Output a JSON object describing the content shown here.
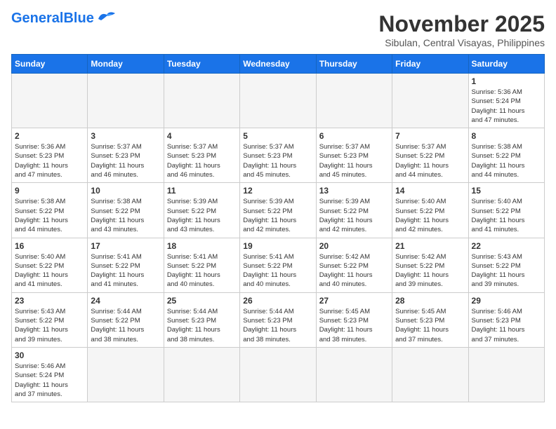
{
  "header": {
    "logo_general": "General",
    "logo_blue": "Blue",
    "month_title": "November 2025",
    "location": "Sibulan, Central Visayas, Philippines"
  },
  "days_of_week": [
    "Sunday",
    "Monday",
    "Tuesday",
    "Wednesday",
    "Thursday",
    "Friday",
    "Saturday"
  ],
  "weeks": [
    [
      {
        "day": "",
        "info": ""
      },
      {
        "day": "",
        "info": ""
      },
      {
        "day": "",
        "info": ""
      },
      {
        "day": "",
        "info": ""
      },
      {
        "day": "",
        "info": ""
      },
      {
        "day": "",
        "info": ""
      },
      {
        "day": "1",
        "info": "Sunrise: 5:36 AM\nSunset: 5:24 PM\nDaylight: 11 hours\nand 47 minutes."
      }
    ],
    [
      {
        "day": "2",
        "info": "Sunrise: 5:36 AM\nSunset: 5:23 PM\nDaylight: 11 hours\nand 47 minutes."
      },
      {
        "day": "3",
        "info": "Sunrise: 5:37 AM\nSunset: 5:23 PM\nDaylight: 11 hours\nand 46 minutes."
      },
      {
        "day": "4",
        "info": "Sunrise: 5:37 AM\nSunset: 5:23 PM\nDaylight: 11 hours\nand 46 minutes."
      },
      {
        "day": "5",
        "info": "Sunrise: 5:37 AM\nSunset: 5:23 PM\nDaylight: 11 hours\nand 45 minutes."
      },
      {
        "day": "6",
        "info": "Sunrise: 5:37 AM\nSunset: 5:23 PM\nDaylight: 11 hours\nand 45 minutes."
      },
      {
        "day": "7",
        "info": "Sunrise: 5:37 AM\nSunset: 5:22 PM\nDaylight: 11 hours\nand 44 minutes."
      },
      {
        "day": "8",
        "info": "Sunrise: 5:38 AM\nSunset: 5:22 PM\nDaylight: 11 hours\nand 44 minutes."
      }
    ],
    [
      {
        "day": "9",
        "info": "Sunrise: 5:38 AM\nSunset: 5:22 PM\nDaylight: 11 hours\nand 44 minutes."
      },
      {
        "day": "10",
        "info": "Sunrise: 5:38 AM\nSunset: 5:22 PM\nDaylight: 11 hours\nand 43 minutes."
      },
      {
        "day": "11",
        "info": "Sunrise: 5:39 AM\nSunset: 5:22 PM\nDaylight: 11 hours\nand 43 minutes."
      },
      {
        "day": "12",
        "info": "Sunrise: 5:39 AM\nSunset: 5:22 PM\nDaylight: 11 hours\nand 42 minutes."
      },
      {
        "day": "13",
        "info": "Sunrise: 5:39 AM\nSunset: 5:22 PM\nDaylight: 11 hours\nand 42 minutes."
      },
      {
        "day": "14",
        "info": "Sunrise: 5:40 AM\nSunset: 5:22 PM\nDaylight: 11 hours\nand 42 minutes."
      },
      {
        "day": "15",
        "info": "Sunrise: 5:40 AM\nSunset: 5:22 PM\nDaylight: 11 hours\nand 41 minutes."
      }
    ],
    [
      {
        "day": "16",
        "info": "Sunrise: 5:40 AM\nSunset: 5:22 PM\nDaylight: 11 hours\nand 41 minutes."
      },
      {
        "day": "17",
        "info": "Sunrise: 5:41 AM\nSunset: 5:22 PM\nDaylight: 11 hours\nand 41 minutes."
      },
      {
        "day": "18",
        "info": "Sunrise: 5:41 AM\nSunset: 5:22 PM\nDaylight: 11 hours\nand 40 minutes."
      },
      {
        "day": "19",
        "info": "Sunrise: 5:41 AM\nSunset: 5:22 PM\nDaylight: 11 hours\nand 40 minutes."
      },
      {
        "day": "20",
        "info": "Sunrise: 5:42 AM\nSunset: 5:22 PM\nDaylight: 11 hours\nand 40 minutes."
      },
      {
        "day": "21",
        "info": "Sunrise: 5:42 AM\nSunset: 5:22 PM\nDaylight: 11 hours\nand 39 minutes."
      },
      {
        "day": "22",
        "info": "Sunrise: 5:43 AM\nSunset: 5:22 PM\nDaylight: 11 hours\nand 39 minutes."
      }
    ],
    [
      {
        "day": "23",
        "info": "Sunrise: 5:43 AM\nSunset: 5:22 PM\nDaylight: 11 hours\nand 39 minutes."
      },
      {
        "day": "24",
        "info": "Sunrise: 5:44 AM\nSunset: 5:22 PM\nDaylight: 11 hours\nand 38 minutes."
      },
      {
        "day": "25",
        "info": "Sunrise: 5:44 AM\nSunset: 5:23 PM\nDaylight: 11 hours\nand 38 minutes."
      },
      {
        "day": "26",
        "info": "Sunrise: 5:44 AM\nSunset: 5:23 PM\nDaylight: 11 hours\nand 38 minutes."
      },
      {
        "day": "27",
        "info": "Sunrise: 5:45 AM\nSunset: 5:23 PM\nDaylight: 11 hours\nand 38 minutes."
      },
      {
        "day": "28",
        "info": "Sunrise: 5:45 AM\nSunset: 5:23 PM\nDaylight: 11 hours\nand 37 minutes."
      },
      {
        "day": "29",
        "info": "Sunrise: 5:46 AM\nSunset: 5:23 PM\nDaylight: 11 hours\nand 37 minutes."
      }
    ],
    [
      {
        "day": "30",
        "info": "Sunrise: 5:46 AM\nSunset: 5:24 PM\nDaylight: 11 hours\nand 37 minutes."
      },
      {
        "day": "",
        "info": ""
      },
      {
        "day": "",
        "info": ""
      },
      {
        "day": "",
        "info": ""
      },
      {
        "day": "",
        "info": ""
      },
      {
        "day": "",
        "info": ""
      },
      {
        "day": "",
        "info": ""
      }
    ]
  ]
}
